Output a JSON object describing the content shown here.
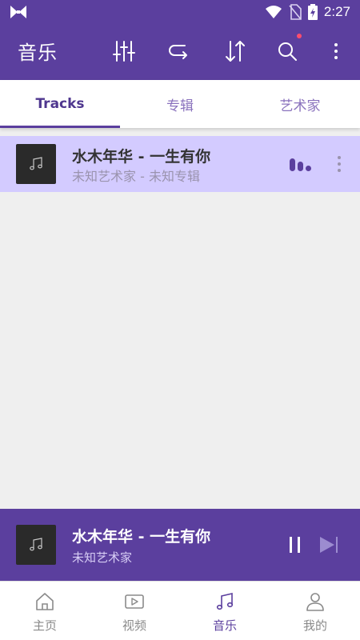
{
  "status_bar": {
    "time": "2:27"
  },
  "app_bar": {
    "title": "音乐",
    "icons": [
      "equalizer-icon",
      "repeat-icon",
      "sort-icon",
      "search-icon",
      "more-vert-icon"
    ]
  },
  "tabs": [
    {
      "label": "Tracks",
      "active": true
    },
    {
      "label": "专辑",
      "active": false
    },
    {
      "label": "艺术家",
      "active": false
    }
  ],
  "tracks": [
    {
      "title": "水木年华 - 一生有你",
      "subtitle": "未知艺术家 - 未知专辑",
      "playing": true
    }
  ],
  "mini_player": {
    "title": "水木年华 - 一生有你",
    "artist": "未知艺术家"
  },
  "bottom_nav": [
    {
      "label": "主页",
      "icon": "home-icon",
      "active": false
    },
    {
      "label": "视频",
      "icon": "video-icon",
      "active": false
    },
    {
      "label": "音乐",
      "icon": "music-note-icon",
      "active": true
    },
    {
      "label": "我的",
      "icon": "person-icon",
      "active": false
    }
  ],
  "colors": {
    "primary": "#5b3f9e",
    "selected_row": "#d3cbff",
    "accent_dot": "#ff4d6d"
  }
}
